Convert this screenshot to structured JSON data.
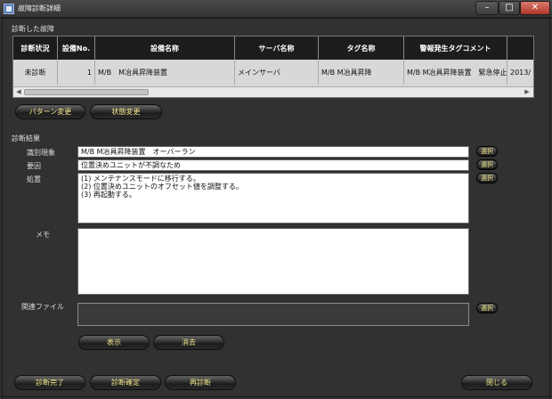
{
  "window": {
    "title": "故障診断詳細"
  },
  "controls": {
    "minimize": "–",
    "maximize": "□",
    "close": "✕"
  },
  "fault_section": {
    "title": "診断した故障"
  },
  "fault_table": {
    "columns": [
      "診断状況",
      "設備No.",
      "設備名称",
      "サーバ名称",
      "タグ名称",
      "警報発生タグコメント",
      ""
    ],
    "rows": [
      [
        "未診断",
        "1",
        "M/B　M冶具昇降装置",
        "メインサーバ",
        "M/B M冶具昇降",
        "M/B M冶具昇降装置　緊急停止",
        "2013/"
      ]
    ],
    "scroll": {
      "left": "◀",
      "right": "▶"
    }
  },
  "buttons": {
    "pattern_change": "パターン変更",
    "status_change": "状態変更",
    "show": "表示",
    "clear": "消去",
    "diagnosis_complete": "診断完了",
    "diagnosis_confirm": "診断確定",
    "rediagnose": "再診断",
    "close": "閉じる"
  },
  "diagnosis": {
    "title": "診断結果",
    "phenomenon_label": "識別現象",
    "phenomenon_value": "M/B M冶具昇降装置　オーバーラン",
    "cause_label": "要因",
    "cause_value": "位置決めユニットが不調なため",
    "action_label": "処置",
    "action_lines": [
      "(1) メンテナンスモードに移行する。",
      "(2) 位置決めユニットのオフセット値を調整する。",
      "(3) 再起動する。"
    ],
    "memo_label": "メモ",
    "memo_value": "",
    "related_file_label": "関連ファイル",
    "select_label": "選択"
  }
}
